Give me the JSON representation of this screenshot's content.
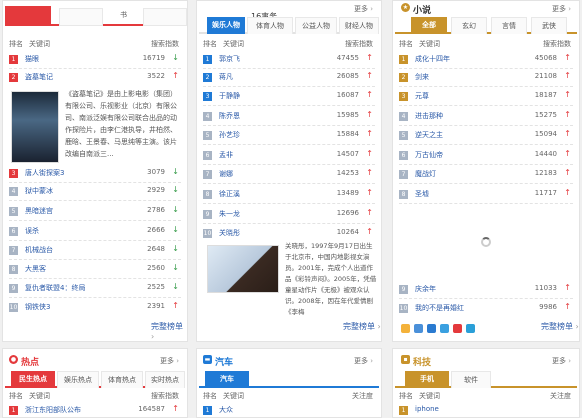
{
  "panels": {
    "left": {
      "tabs": [
        "",
        "书"
      ],
      "header": {
        "rank": "排名",
        "keyword": "关键词",
        "index": "搜索指数"
      },
      "rows": [
        {
          "num": "1",
          "keyword": "猫眼",
          "value": "16719",
          "trend": "down"
        },
        {
          "num": "2",
          "keyword": "盗墓笔记",
          "value": "3522",
          "trend": "up"
        },
        {
          "num": "3",
          "keyword": "唐人街探案3",
          "value": "3079",
          "trend": "down"
        },
        {
          "num": "4",
          "keyword": "狱中蒙冰",
          "value": "2929",
          "trend": "down"
        },
        {
          "num": "5",
          "keyword": "黑暗迷宫",
          "value": "2786",
          "trend": "down"
        },
        {
          "num": "6",
          "keyword": "误杀",
          "value": "2666",
          "trend": "down"
        },
        {
          "num": "7",
          "keyword": "机械战台",
          "value": "2648",
          "trend": "down"
        },
        {
          "num": "8",
          "keyword": "大黑客",
          "value": "2560",
          "trend": "down"
        },
        {
          "num": "9",
          "keyword": "复仇者联盟4：终局",
          "value": "2525",
          "trend": "down"
        },
        {
          "num": "10",
          "keyword": "钢铁侠3",
          "value": "2391",
          "trend": "up"
        }
      ],
      "feature": "《盗墓笔记》是由上影电影（集团）有限公司、乐视影业（北京）有限公司、南派泛娱有限公司联合出品的动作探险片，由李仁港执导，井柏然、鹿晗、王景春、马思纯等主演。该片改编自南派三...",
      "more_link": "完整榜单"
    },
    "mid": {
      "tabs": [
        "娱乐人物",
        "体育人物",
        "公益人物",
        "财经人物"
      ],
      "top_fragment": "16事务",
      "more": "更多",
      "header": {
        "rank": "排名",
        "keyword": "关键词",
        "index": "搜索指数"
      },
      "rows": [
        {
          "num": "1",
          "keyword": "郭京飞",
          "value": "47455",
          "trend": "up"
        },
        {
          "num": "2",
          "keyword": "蒋凡",
          "value": "26085",
          "trend": "up"
        },
        {
          "num": "3",
          "keyword": "于静静",
          "value": "16087",
          "trend": "up"
        },
        {
          "num": "4",
          "keyword": "陈乔恩",
          "value": "15985",
          "trend": "up"
        },
        {
          "num": "5",
          "keyword": "孙艺珍",
          "value": "15884",
          "trend": "up"
        },
        {
          "num": "6",
          "keyword": "孟非",
          "value": "14507",
          "trend": "up"
        },
        {
          "num": "7",
          "keyword": "谢娜",
          "value": "14253",
          "trend": "up"
        },
        {
          "num": "8",
          "keyword": "徐正溪",
          "value": "13489",
          "trend": "up"
        },
        {
          "num": "9",
          "keyword": "朱一龙",
          "value": "12696",
          "trend": "up"
        },
        {
          "num": "10",
          "keyword": "关晓彤",
          "value": "10264",
          "trend": "up"
        }
      ],
      "feature": "关晓彤，1997年9月17日出生于北京市，中国内地影视女演员。2001年，完成个人出道作品《彩铃声闷》。2005年，凭借童星动作片《无极》被观众认识。2008年，因在年代爱情剧《李梅",
      "more_link": "完整榜单"
    },
    "right": {
      "title": "小说",
      "more": "更多",
      "tabs": [
        "全部",
        "玄幻",
        "言情",
        "武侠"
      ],
      "header": {
        "rank": "排名",
        "keyword": "关键词",
        "index": "搜索指数"
      },
      "rows": [
        {
          "num": "1",
          "keyword": "成化十四年",
          "value": "45068",
          "trend": "up"
        },
        {
          "num": "2",
          "keyword": "剑来",
          "value": "21108",
          "trend": "up"
        },
        {
          "num": "3",
          "keyword": "元尊",
          "value": "18187",
          "trend": "up"
        },
        {
          "num": "4",
          "keyword": "进击那种",
          "value": "15275",
          "trend": "up"
        },
        {
          "num": "5",
          "keyword": "逆天之主",
          "value": "15094",
          "trend": "up"
        },
        {
          "num": "6",
          "keyword": "万古仙帝",
          "value": "14440",
          "trend": "up"
        },
        {
          "num": "7",
          "keyword": "魔战灯",
          "value": "12183",
          "trend": "up"
        },
        {
          "num": "8",
          "keyword": "圣墟",
          "value": "11717",
          "trend": "up"
        },
        {
          "num": "9",
          "keyword": "庆余年",
          "value": "11033",
          "trend": "up"
        },
        {
          "num": "10",
          "keyword": "我的不是再婚红",
          "value": "9986",
          "trend": "up"
        }
      ],
      "more_link": "完整榜单"
    },
    "hot": {
      "title": "热点",
      "more": "更多",
      "tabs": [
        "民生热点",
        "娱乐热点",
        "体育热点",
        "实时热点"
      ],
      "header": {
        "rank": "排名",
        "keyword": "关键词",
        "index": "搜索指数"
      },
      "row1": {
        "num": "1",
        "keyword": "浙江东阳部队公布",
        "value": "164587"
      }
    },
    "car": {
      "title": "汽车",
      "more": "更多",
      "tabs": [
        "汽车"
      ],
      "header": {
        "rank": "排名",
        "keyword": "关键词",
        "index": "关注度"
      },
      "row1": {
        "num": "1",
        "keyword": "大众"
      }
    },
    "tech": {
      "title": "科技",
      "more": "更多",
      "tabs": [
        "手机",
        "软件"
      ],
      "header": {
        "rank": "排名",
        "keyword": "关键词",
        "index": "关注度"
      },
      "row1": {
        "num": "1",
        "keyword": "iphone"
      }
    }
  },
  "colors": {
    "red": "#e4393c",
    "blue": "#1f7ad6",
    "gold": "#c8932b",
    "green": "#3a9d4d"
  }
}
